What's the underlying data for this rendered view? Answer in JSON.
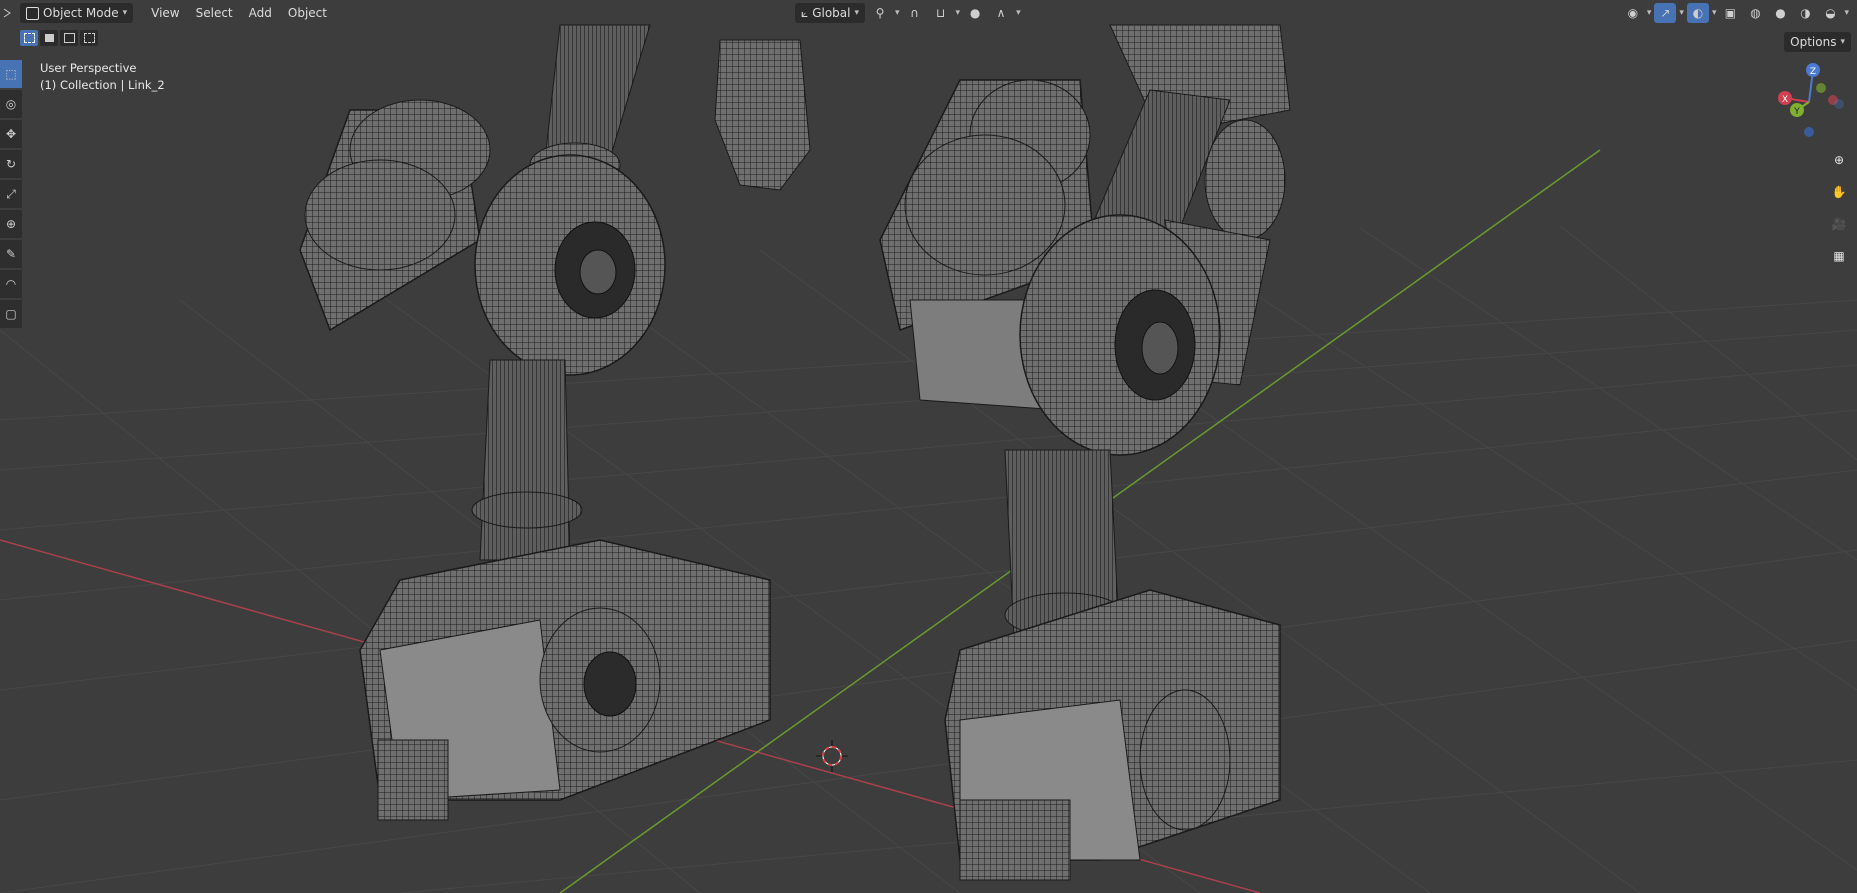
{
  "header": {
    "mode_label": "Object Mode",
    "menus": [
      "View",
      "Select",
      "Add",
      "Object"
    ],
    "transform_orientation": "Global"
  },
  "viewport": {
    "perspective_label": "User Perspective",
    "collection_label": "(1) Collection | Link_2",
    "options_label": "Options"
  },
  "gizmo": {
    "z": "Z",
    "x": "X",
    "y": "Y"
  },
  "icons": {
    "toolbar": [
      "select-box-icon",
      "cursor-icon",
      "move-icon",
      "rotate-icon",
      "scale-icon",
      "transform-icon",
      "annotate-icon",
      "measure-icon",
      "add-cube-icon"
    ],
    "navigation": [
      "zoom-icon",
      "pan-hand-icon",
      "camera-icon",
      "grid-view-icon"
    ]
  },
  "colors": {
    "viewport_bg": "#3d3d3d",
    "grid_line": "#464646",
    "x_axis": "#a8414b",
    "y_axis": "#6a9a2f",
    "active_button": "#4772b3",
    "mesh_fill": "#7a7a7a",
    "wire": "#1b1b1b"
  }
}
